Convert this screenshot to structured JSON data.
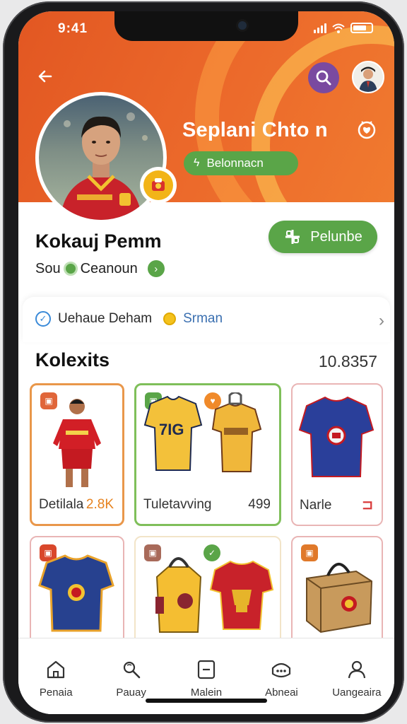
{
  "status_bar": {
    "time": "9:41"
  },
  "header": {
    "profile_name": "Seplani Chto n",
    "pill_label": "Belonnacn"
  },
  "profile": {
    "name": "Kokauj Pemm",
    "subtitle_left": "Sou",
    "subtitle_right": "Ceanoun",
    "follow_label": "Pelunbe"
  },
  "info": {
    "text": "Uehaue Deham",
    "suffix": "Srman"
  },
  "collection": {
    "title": "Kolexits",
    "count": "10.8357",
    "items": [
      {
        "label": "Detilala",
        "value": "2.8K",
        "value_color": "#e6821e"
      },
      {
        "label": "Tuletavving",
        "value": "499",
        "value_color": "#333333"
      },
      {
        "label": "Narle",
        "value": "",
        "value_color": "#333333"
      },
      {
        "label": "",
        "value": ""
      },
      {
        "label": "",
        "value": ""
      },
      {
        "label": "",
        "value": ""
      }
    ]
  },
  "tabs": [
    {
      "label": "Penaia",
      "icon": "home-icon"
    },
    {
      "label": "Pauay",
      "icon": "search-icon"
    },
    {
      "label": "Malein",
      "icon": "box-icon"
    },
    {
      "label": "Abneai",
      "icon": "chat-icon"
    },
    {
      "label": "Uangeaira",
      "icon": "profile-icon"
    }
  ],
  "colors": {
    "accent_orange": "#e85f24",
    "accent_green": "#5aa548",
    "accent_purple": "#7a4aa0"
  }
}
